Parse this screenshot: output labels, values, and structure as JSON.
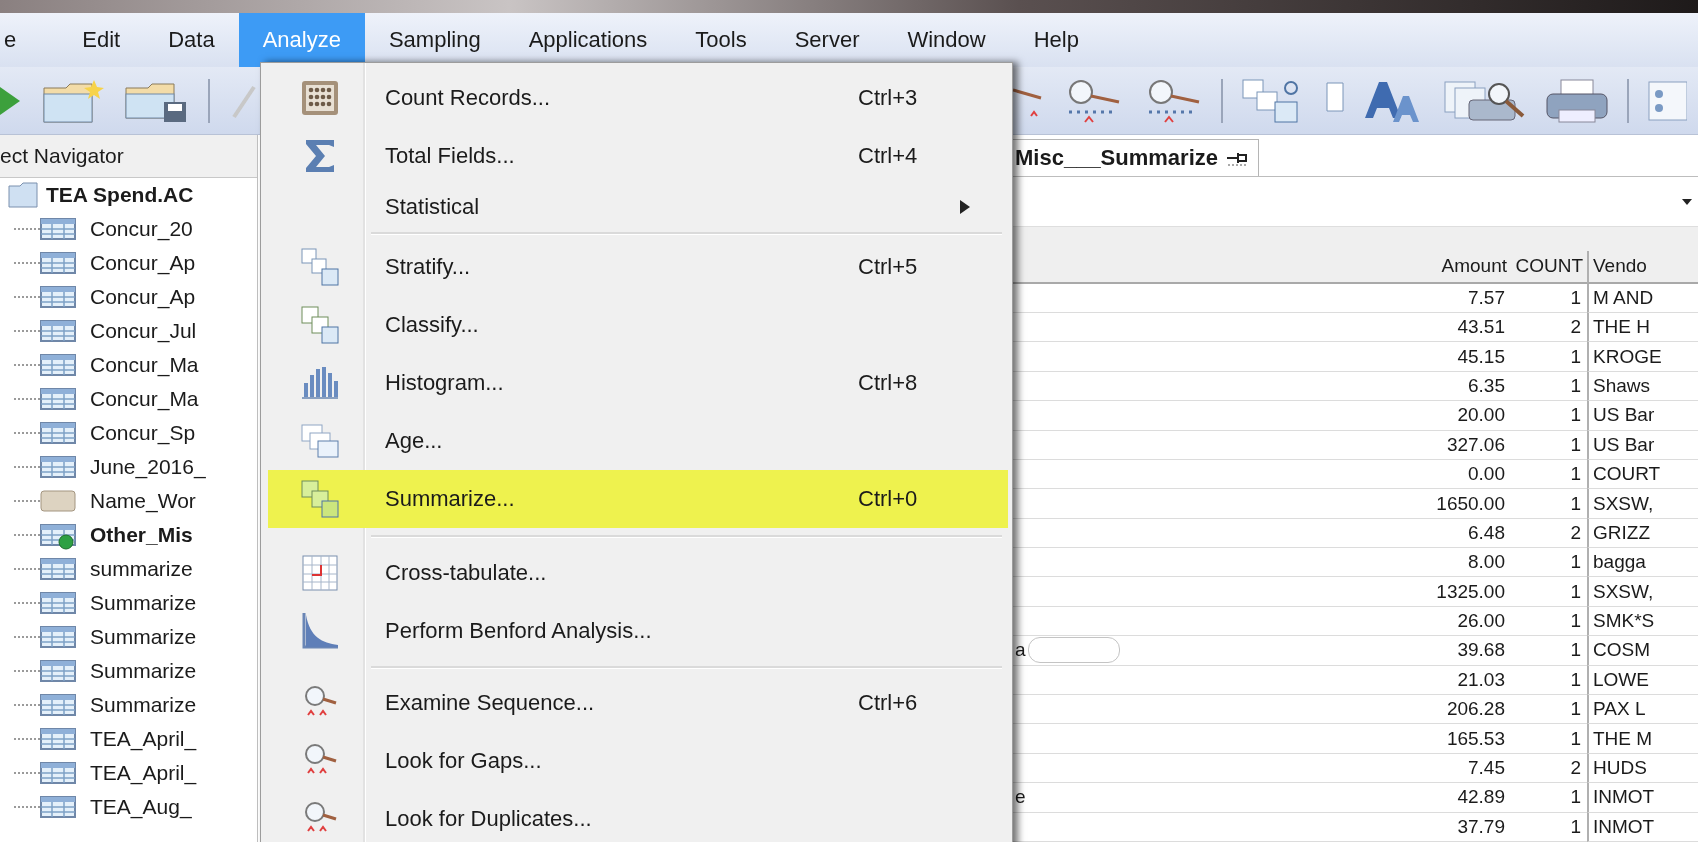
{
  "menubar": [
    {
      "label": "e",
      "selected": false
    },
    {
      "label": "Edit",
      "selected": false
    },
    {
      "label": "Data",
      "selected": false
    },
    {
      "label": "Analyze",
      "selected": true
    },
    {
      "label": "Sampling",
      "selected": false
    },
    {
      "label": "Applications",
      "selected": false
    },
    {
      "label": "Tools",
      "selected": false
    },
    {
      "label": "Server",
      "selected": false
    },
    {
      "label": "Window",
      "selected": false
    },
    {
      "label": "Help",
      "selected": false
    }
  ],
  "navigator": {
    "title": "ect Navigator",
    "root": {
      "label": "TEA Spend.AC",
      "children": [
        {
          "label": "Concur_20",
          "kind": "table",
          "active": false
        },
        {
          "label": "Concur_Ap",
          "kind": "table",
          "active": false
        },
        {
          "label": "Concur_Ap",
          "kind": "table",
          "active": false
        },
        {
          "label": "Concur_Jul",
          "kind": "table",
          "active": false
        },
        {
          "label": "Concur_Ma",
          "kind": "table",
          "active": false
        },
        {
          "label": "Concur_Ma",
          "kind": "table",
          "active": false
        },
        {
          "label": "Concur_Sp",
          "kind": "table",
          "active": false
        },
        {
          "label": "June_2016_",
          "kind": "table",
          "active": false
        },
        {
          "label": "Name_Wor",
          "kind": "workspace",
          "active": false
        },
        {
          "label": "Other_Mis",
          "kind": "table",
          "active": true
        },
        {
          "label": "summarize",
          "kind": "table",
          "active": false
        },
        {
          "label": "Summarize",
          "kind": "table",
          "active": false
        },
        {
          "label": "Summarize",
          "kind": "table",
          "active": false
        },
        {
          "label": "Summarize",
          "kind": "table",
          "active": false
        },
        {
          "label": "Summarize",
          "kind": "table",
          "active": false
        },
        {
          "label": "TEA_April_",
          "kind": "table",
          "active": false
        },
        {
          "label": "TEA_April_",
          "kind": "table",
          "active": false
        },
        {
          "label": "TEA_Aug_",
          "kind": "table",
          "active": false
        }
      ]
    }
  },
  "document_tab": {
    "label": "Misc___Summarize"
  },
  "table": {
    "columns": [
      "Amount",
      "COUNT",
      "Vendo"
    ],
    "rows": [
      {
        "amount": "7.57",
        "count": "1",
        "vendor": "M AND"
      },
      {
        "amount": "43.51",
        "count": "2",
        "vendor": "THE H"
      },
      {
        "amount": "45.15",
        "count": "1",
        "vendor": "KROGE"
      },
      {
        "amount": "6.35",
        "count": "1",
        "vendor": "Shaws"
      },
      {
        "amount": "20.00",
        "count": "1",
        "vendor": "US Bar"
      },
      {
        "amount": "327.06",
        "count": "1",
        "vendor": "US Bar"
      },
      {
        "amount": "0.00",
        "count": "1",
        "vendor": "COURT"
      },
      {
        "amount": "1650.00",
        "count": "1",
        "vendor": "SXSW,"
      },
      {
        "amount": "6.48",
        "count": "2",
        "vendor": "GRIZZ"
      },
      {
        "amount": "8.00",
        "count": "1",
        "vendor": "bagga"
      },
      {
        "amount": "1325.00",
        "count": "1",
        "vendor": "SXSW,"
      },
      {
        "amount": "26.00",
        "count": "1",
        "vendor": "SMK*S"
      },
      {
        "column_1": "a",
        "redacted": true,
        "amount": "39.68",
        "count": "1",
        "vendor": "COSM"
      },
      {
        "amount": "21.03",
        "count": "1",
        "vendor": "LOWE"
      },
      {
        "amount": "206.28",
        "count": "1",
        "vendor": "PAX L"
      },
      {
        "amount": "165.53",
        "count": "1",
        "vendor": "THE M"
      },
      {
        "amount": "7.45",
        "count": "2",
        "vendor": "HUDS"
      },
      {
        "column_1": "e",
        "amount": "42.89",
        "count": "1",
        "vendor": "INMOT"
      },
      {
        "amount": "37.79",
        "count": "1",
        "vendor": "INMOT"
      }
    ]
  },
  "menu": {
    "items": [
      {
        "kind": "item",
        "label": "Count Records...",
        "shortcut": "Ctrl+3",
        "selected": false
      },
      {
        "kind": "item",
        "label": "Total Fields...",
        "shortcut": "Ctrl+4",
        "selected": false
      },
      {
        "kind": "submenu",
        "label": "Statistical",
        "selected": false
      },
      {
        "kind": "separator"
      },
      {
        "kind": "item",
        "label": "Stratify...",
        "shortcut": "Ctrl+5",
        "selected": false
      },
      {
        "kind": "item",
        "label": "Classify...",
        "selected": false
      },
      {
        "kind": "item",
        "label": "Histogram...",
        "shortcut": "Ctrl+8",
        "selected": false
      },
      {
        "kind": "item",
        "label": "Age...",
        "selected": false
      },
      {
        "kind": "item",
        "label": "Summarize...",
        "shortcut": "Ctrl+0",
        "selected": true
      },
      {
        "kind": "separator"
      },
      {
        "kind": "item",
        "label": "Cross-tabulate...",
        "selected": false
      },
      {
        "kind": "item",
        "label": "Perform Benford Analysis...",
        "selected": false
      },
      {
        "kind": "separator"
      },
      {
        "kind": "item",
        "label": "Examine Sequence...",
        "shortcut": "Ctrl+6",
        "selected": false
      },
      {
        "kind": "item",
        "label": "Look for Gaps...",
        "selected": false
      },
      {
        "kind": "item",
        "label": "Look for Duplicates...",
        "selected": false
      }
    ]
  }
}
